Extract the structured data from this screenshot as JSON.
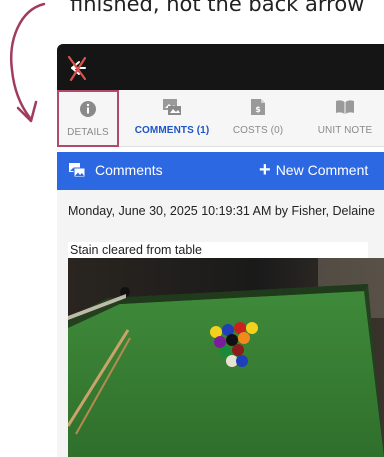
{
  "caption": {
    "text": "finished, not the back arrow"
  },
  "topbar": {
    "back_icon": "back-arrow-crossed-out-icon"
  },
  "tabs": [
    {
      "label": "DETAILS",
      "icon": "info-icon",
      "active": false,
      "highlighted": true
    },
    {
      "label": "COMMENTS (1)",
      "icon": "image-comment-icon",
      "active": true
    },
    {
      "label": "COSTS (0)",
      "icon": "cost-document-icon",
      "active": false
    },
    {
      "label": "UNIT NOTE",
      "icon": "book-icon",
      "active": false
    }
  ],
  "comments_bar": {
    "title": "Comments",
    "new_label": "New Comment"
  },
  "comment": {
    "meta": "Monday, June 30, 2025 10:19:31 AM by Fisher, Delaine",
    "text": "Stain cleared from table"
  },
  "colors": {
    "accent": "#2d68e3",
    "highlight": "#b04a6a",
    "topbar": "#151515",
    "active_tab": "#1d55c6"
  }
}
